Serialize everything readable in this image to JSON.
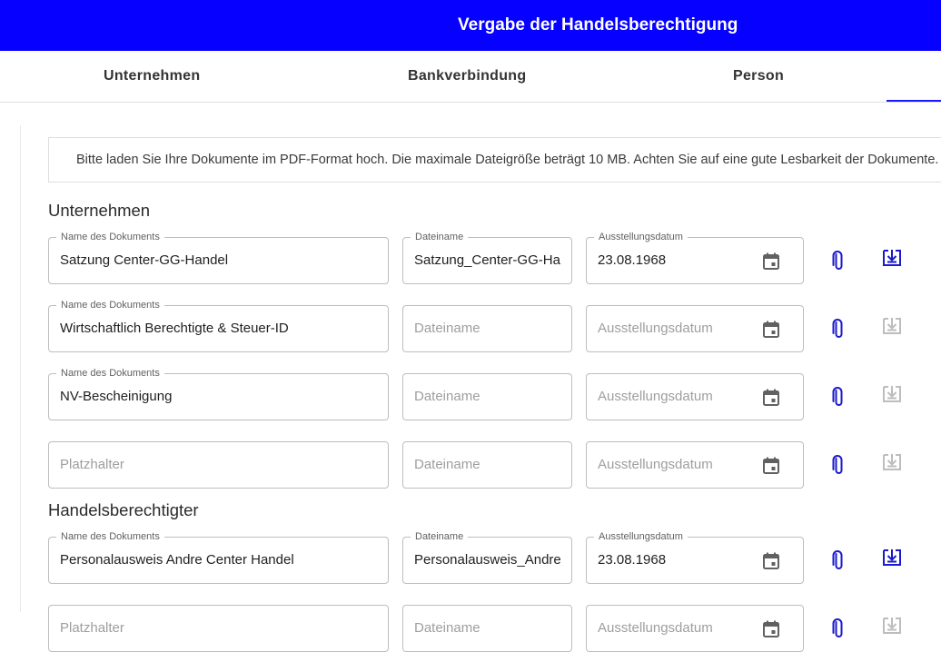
{
  "header": {
    "title": "Vergabe der Handelsberechtigung"
  },
  "tabs": [
    "Unternehmen",
    "Bankverbindung",
    "Person"
  ],
  "info": {
    "text": "Bitte laden Sie Ihre Dokumente im PDF-Format hoch. Die maximale Dateigröße beträgt 10 MB. Achten Sie auf eine gute Lesbarkeit der Dokumente."
  },
  "labels": {
    "doc_name": "Name des Dokuments",
    "file_name": "Dateiname",
    "issue_date": "Ausstellungsdatum"
  },
  "placeholders": {
    "doc_name": "Platzhalter",
    "file_name": "Dateiname",
    "issue_date": "Ausstellungsdatum"
  },
  "sections": [
    {
      "title": "Unternehmen",
      "rows": [
        {
          "doc_name": "Satzung Center-GG-Handel",
          "file_name": "Satzung_Center-GG-Handel",
          "issue_date": "23.08.1968",
          "download_enabled": true
        },
        {
          "doc_name": "Wirtschaftlich Berechtigte & Steuer-ID",
          "file_name": "",
          "issue_date": "",
          "download_enabled": false
        },
        {
          "doc_name": "NV-Bescheinigung",
          "file_name": "",
          "issue_date": "",
          "download_enabled": false
        },
        {
          "doc_name": "",
          "file_name": "",
          "issue_date": "",
          "download_enabled": false
        }
      ]
    },
    {
      "title": "Handelsberechtigter",
      "rows": [
        {
          "doc_name": "Personalausweis Andre Center Handel",
          "file_name": "Personalausweis_Andre_Center_Handel",
          "issue_date": "23.08.1968",
          "download_enabled": true
        },
        {
          "doc_name": "",
          "file_name": "",
          "issue_date": "",
          "download_enabled": false
        }
      ]
    }
  ],
  "colors": {
    "primary": "#0500ff",
    "icon_active": "#1a1acc",
    "icon_disabled": "#bdbdbd"
  },
  "icons": {
    "attach": "paperclip-icon",
    "download": "download-icon",
    "calendar": "calendar-icon"
  }
}
